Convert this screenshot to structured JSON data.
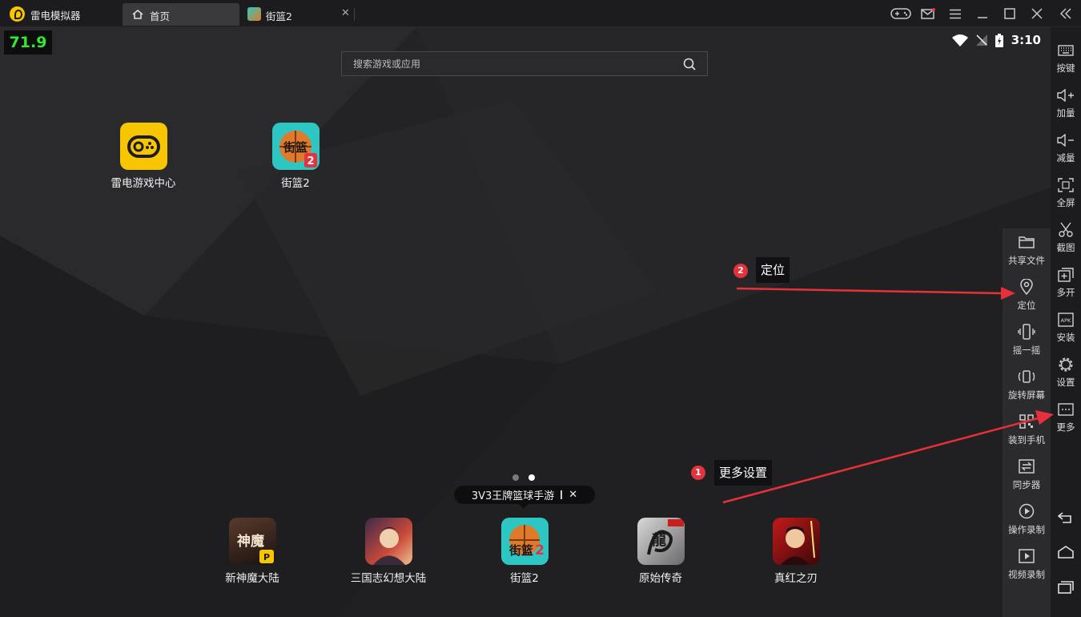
{
  "titlebar": {
    "app_title": "雷电模拟器",
    "tabs": [
      {
        "label": "首页",
        "icon": "home-icon"
      },
      {
        "label": "街篮2",
        "icon": "game-thumbnail-icon",
        "close": "✕"
      }
    ],
    "window_controls": [
      "gamepad-icon",
      "mail-icon",
      "menu-icon",
      "minimize-icon",
      "maximize-icon",
      "close-icon",
      "collapse-icon"
    ]
  },
  "screen": {
    "fps": "71.9",
    "status": {
      "time": "3:10",
      "icons": [
        "wifi-icon",
        "no-signal-icon",
        "battery-charging-icon"
      ]
    },
    "search": {
      "placeholder": "搜索游戏或应用"
    },
    "desktop_apps": [
      {
        "name": "雷电游戏中心"
      },
      {
        "name": "街篮2"
      }
    ],
    "page_dots": {
      "count": 2,
      "active": 2
    },
    "tooltip": {
      "text": "3V3王牌篮球手游",
      "close": "✕"
    },
    "dock_apps": [
      {
        "name": "新神魔大陆"
      },
      {
        "name": "三国志幻想大陆"
      },
      {
        "name": "街篮2"
      },
      {
        "name": "原始传奇"
      },
      {
        "name": "真红之刃"
      }
    ]
  },
  "annotations": [
    {
      "num": "2",
      "label": "定位"
    },
    {
      "num": "1",
      "label": "更多设置"
    }
  ],
  "arrow_color": "#e8303a",
  "popup": {
    "items": [
      {
        "label": "共享文件",
        "icon": "folder-icon"
      },
      {
        "label": "定位",
        "icon": "location-pin-icon"
      },
      {
        "label": "摇一摇",
        "icon": "shake-icon"
      },
      {
        "label": "旋转屏幕",
        "icon": "rotate-icon"
      },
      {
        "label": "装到手机",
        "icon": "qr-code-icon"
      },
      {
        "label": "同步器",
        "icon": "sync-icon"
      },
      {
        "label": "操作录制",
        "icon": "play-circle-icon"
      },
      {
        "label": "视频录制",
        "icon": "video-record-icon"
      }
    ]
  },
  "sidebar": {
    "items": [
      {
        "label": "按键",
        "icon": "keyboard-icon"
      },
      {
        "label": "加量",
        "icon": "volume-up-icon"
      },
      {
        "label": "减量",
        "icon": "volume-down-icon"
      },
      {
        "label": "全屏",
        "icon": "fullscreen-icon"
      },
      {
        "label": "截图",
        "icon": "scissors-icon"
      },
      {
        "label": "多开",
        "icon": "multi-instance-icon"
      },
      {
        "label": "安装",
        "icon": "apk-icon"
      },
      {
        "label": "设置",
        "icon": "gear-icon"
      },
      {
        "label": "更多",
        "icon": "more-icon"
      }
    ],
    "nav": [
      "back-icon",
      "home-icon",
      "recent-apps-icon"
    ]
  }
}
